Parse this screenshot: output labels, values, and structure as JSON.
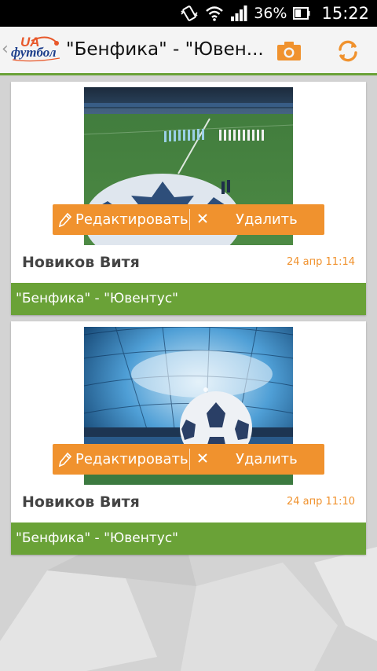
{
  "status_bar": {
    "battery": "36%",
    "time": "15:22",
    "icons": [
      "vibrate-icon",
      "wifi-icon",
      "signal-icon",
      "battery-icon"
    ]
  },
  "action_bar": {
    "logo_ua": "UA",
    "logo_football": "футбол",
    "title": "\"Бенфика\" - \"Ювен...",
    "actions": [
      "camera-icon",
      "refresh-icon"
    ]
  },
  "photos": [
    {
      "image": "champions-league-ceremony-photo",
      "edit_label": "Редактировать",
      "delete_label": "Удалить",
      "author": "Новиков Витя",
      "time": "24 апр 11:14",
      "caption": "\"Бенфика\" - \"Ювентус\""
    },
    {
      "image": "stadium-roof-ball-photo",
      "edit_label": "Редактировать",
      "delete_label": "Удалить",
      "author": "Новиков Витя",
      "time": "24 апр 11:10",
      "caption": "\"Бенфика\" - \"Ювентус\""
    }
  ],
  "colors": {
    "accent_orange": "#f0922e",
    "caption_green": "#6aa237",
    "background": "#d6d6d6"
  }
}
